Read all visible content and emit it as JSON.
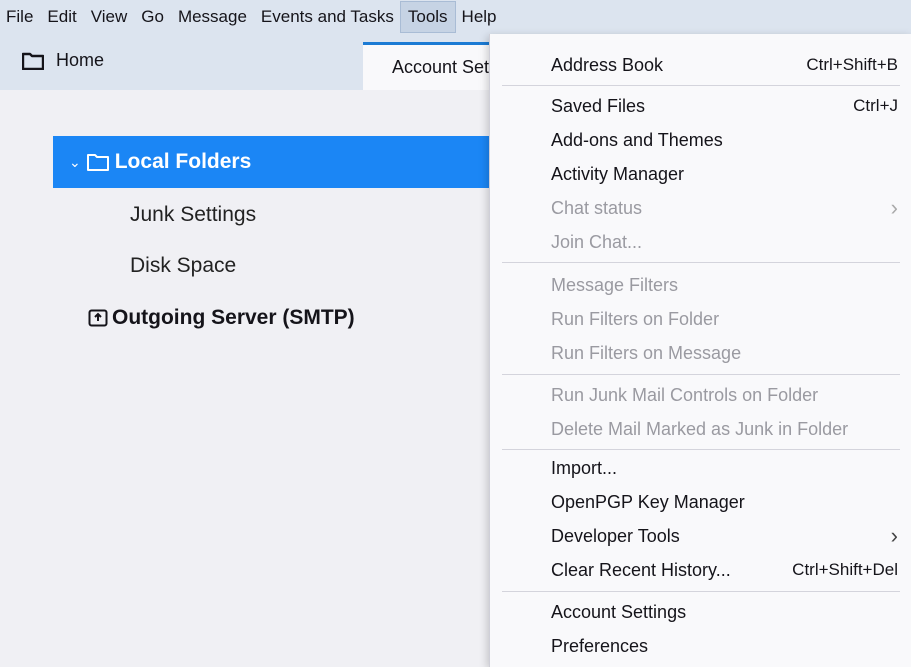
{
  "menubar": {
    "items": [
      "File",
      "Edit",
      "View",
      "Go",
      "Message",
      "Events and Tasks",
      "Tools",
      "Help"
    ],
    "active": "Tools"
  },
  "tabs": {
    "home": "Home",
    "account": "Account Settings"
  },
  "tree": {
    "local_folders": "Local Folders",
    "junk_settings": "Junk Settings",
    "disk_space": "Disk Space",
    "outgoing_server": "Outgoing Server (SMTP)"
  },
  "tools_menu": {
    "address_book": {
      "label": "Address Book",
      "shortcut": "Ctrl+Shift+B"
    },
    "saved_files": {
      "label": "Saved Files",
      "shortcut": "Ctrl+J"
    },
    "addons": {
      "label": "Add-ons and Themes"
    },
    "activity_manager": {
      "label": "Activity Manager"
    },
    "chat_status": {
      "label": "Chat status"
    },
    "join_chat": {
      "label": "Join Chat..."
    },
    "message_filters": {
      "label": "Message Filters"
    },
    "run_filters_folder": {
      "label": "Run Filters on Folder"
    },
    "run_filters_message": {
      "label": "Run Filters on Message"
    },
    "run_junk": {
      "label": "Run Junk Mail Controls on Folder"
    },
    "delete_junk": {
      "label": "Delete Mail Marked as Junk in Folder"
    },
    "import": {
      "label": "Import..."
    },
    "openpgp": {
      "label": "OpenPGP Key Manager"
    },
    "developer_tools": {
      "label": "Developer Tools"
    },
    "clear_history": {
      "label": "Clear Recent History...",
      "shortcut": "Ctrl+Shift+Del"
    },
    "account_settings": {
      "label": "Account Settings"
    },
    "preferences": {
      "label": "Preferences"
    }
  },
  "colors": {
    "accent": "#1b86f5",
    "menubar_bg": "#dce4ef"
  }
}
